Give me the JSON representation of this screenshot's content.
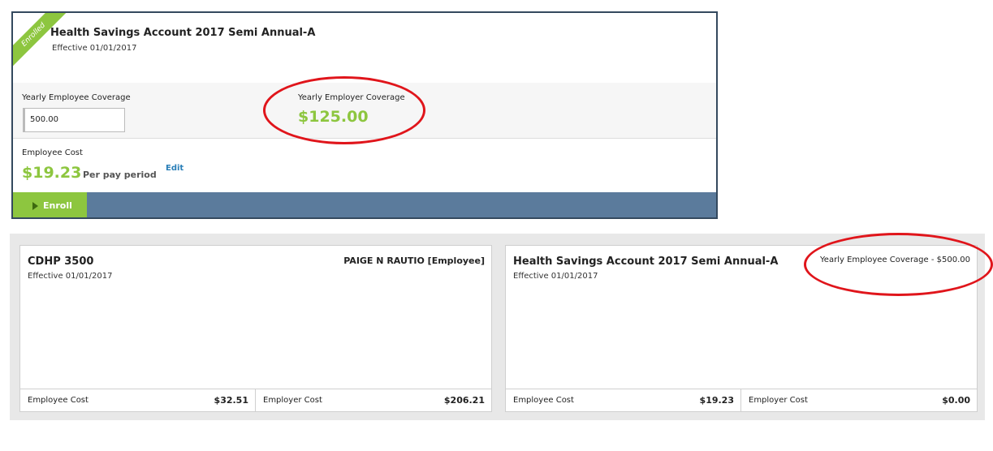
{
  "top_card": {
    "badge": "Enrolled",
    "title": "Health Savings Account 2017 Semi Annual-A",
    "effective": "Effective 01/01/2017",
    "employee_coverage_label": "Yearly Employee Coverage",
    "employee_coverage_value": "500.00",
    "employer_coverage_label": "Yearly Employer Coverage",
    "employer_coverage_value": "$125.00",
    "employee_cost_label": "Employee Cost",
    "employee_cost_value": "$19.23",
    "per_pay_period": "Per pay period",
    "edit_label": "Edit",
    "enroll_label": "Enroll"
  },
  "plans": [
    {
      "title": "CDHP 3500",
      "effective": "Effective 01/01/2017",
      "right_text": "PAIGE N RAUTIO [Employee]",
      "employee_cost_label": "Employee Cost",
      "employee_cost_value": "$32.51",
      "employer_cost_label": "Employer Cost",
      "employer_cost_value": "$206.21"
    },
    {
      "title": "Health Savings Account 2017 Semi Annual-A",
      "effective": "Effective 01/01/2017",
      "right_text": "Yearly Employee Coverage - $500.00",
      "employee_cost_label": "Employee Cost",
      "employee_cost_value": "$19.23",
      "employer_cost_label": "Employer Cost",
      "employer_cost_value": "$0.00"
    }
  ],
  "colors": {
    "accent_green": "#8dc63f",
    "bar_blue": "#5b7b9c",
    "annotation_red": "#e0151b",
    "link_blue": "#2a7fb8"
  }
}
